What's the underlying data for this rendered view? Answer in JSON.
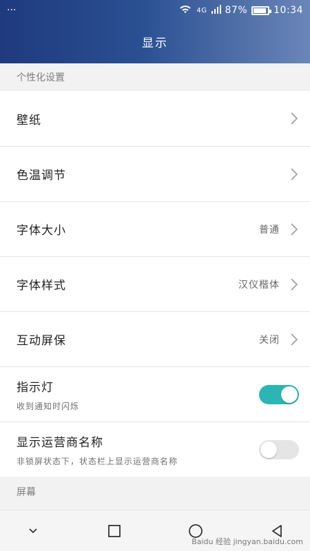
{
  "status_bar": {
    "menu_dots": "···",
    "network_label": "4G",
    "battery_percent": "87%",
    "time": "10:34"
  },
  "page": {
    "title": "显示"
  },
  "sections": {
    "personalization_title": "个性化设置",
    "screen_title": "屏幕"
  },
  "rows": [
    {
      "label": "壁纸"
    },
    {
      "label": "色温调节"
    },
    {
      "label": "字体大小",
      "value": "普通"
    },
    {
      "label": "字体样式",
      "value": "汉仪楷体"
    },
    {
      "label": "互动屏保",
      "value": "关闭"
    },
    {
      "label": "指示灯",
      "sub": "收到通知时闪烁",
      "toggle": true
    },
    {
      "label": "显示运营商名称",
      "sub": "非锁屏状态下，状态栏上显示运营商名称",
      "toggle": false
    }
  ],
  "navbar": {
    "watermark": "Baidu 经验 jingyan.baidu.com"
  },
  "colors": {
    "header_start": "#1f3a7f",
    "toggle_on": "#2bb5b5",
    "toggle_off": "#e5e5e5"
  }
}
